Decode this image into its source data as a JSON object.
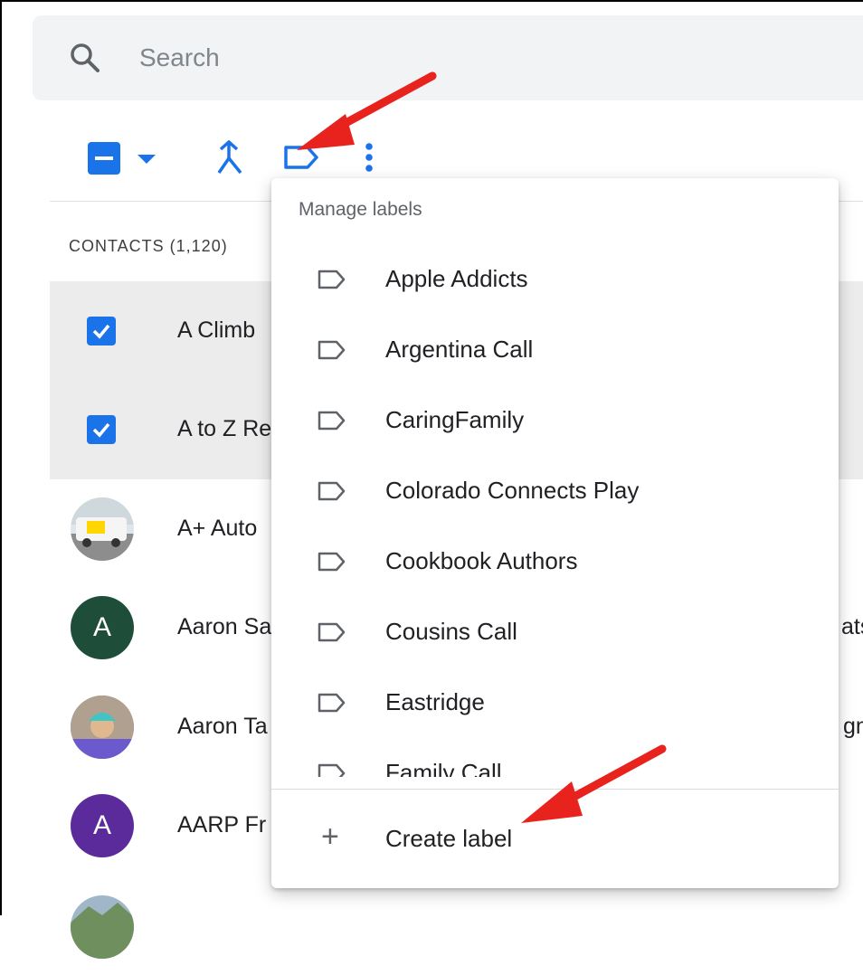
{
  "search": {
    "placeholder": "Search"
  },
  "toolbar": {
    "select_icon": "minus-checkbox-icon",
    "select_dropdown_icon": "caret-down-icon",
    "merge_icon": "merge-icon",
    "label_icon": "label-icon",
    "more_icon": "more-vert-icon"
  },
  "contacts": {
    "count_label": "CONTACTS (1,120)",
    "rows": [
      {
        "name": "A Climb",
        "selected": true
      },
      {
        "name": "A to Z Re",
        "selected": true
      },
      {
        "name": "A+ Auto",
        "avatar": "photo"
      },
      {
        "name": "Aaron Sa",
        "avatar_letter": "A",
        "avatar_color": "#1e4d3a",
        "extra": "ats"
      },
      {
        "name": "Aaron Ta",
        "avatar": "photo",
        "extra": "gm"
      },
      {
        "name": "AARP Fr",
        "avatar_letter": "A",
        "avatar_color": "#5b2a9b"
      }
    ]
  },
  "menu": {
    "header": "Manage labels",
    "items": [
      "Apple Addicts",
      "Argentina Call",
      "CaringFamily",
      "Colorado Connects Play",
      "Cookbook Authors",
      "Cousins Call",
      "Eastridge",
      "Family Call"
    ],
    "create_label": "Create label"
  },
  "colors": {
    "accent": "#1a73e8",
    "arrow": "#e8231e",
    "selected_row": "#ececec"
  }
}
